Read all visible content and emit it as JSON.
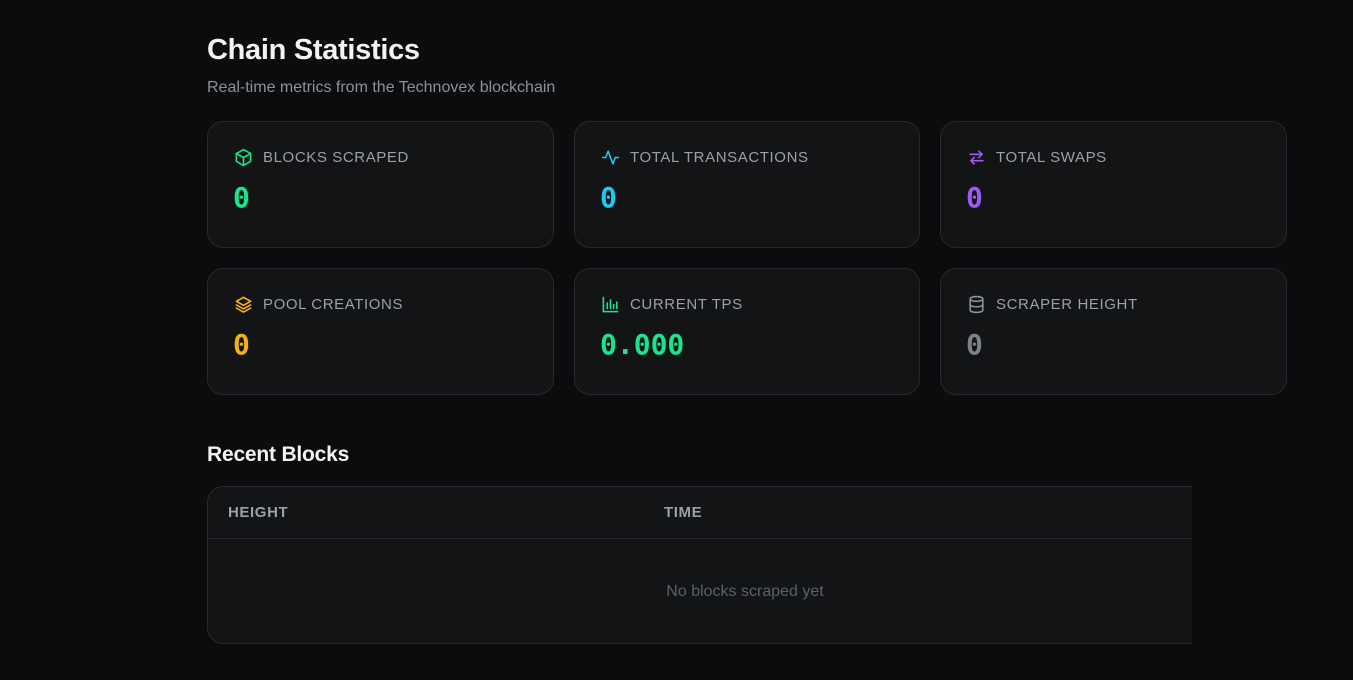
{
  "header": {
    "title": "Chain Statistics",
    "subtitle": "Real-time metrics from the Technovex blockchain"
  },
  "stats": [
    {
      "label": "BLOCKS SCRAPED",
      "value": "0",
      "icon": "cube-icon",
      "color": "#19e68c"
    },
    {
      "label": "TOTAL TRANSACTIONS",
      "value": "0",
      "icon": "activity-icon",
      "color": "#1fc8f0"
    },
    {
      "label": "TOTAL SWAPS",
      "value": "0",
      "icon": "swap-arrows-icon",
      "color": "#9b5cf6"
    },
    {
      "label": "POOL CREATIONS",
      "value": "0",
      "icon": "layers-icon",
      "color": "#f5b014"
    },
    {
      "label": "CURRENT TPS",
      "value": "0.000",
      "icon": "bar-chart-icon",
      "color": "#19e68c"
    },
    {
      "label": "SCRAPER HEIGHT",
      "value": "0",
      "icon": "database-icon",
      "color": "#7c818a"
    }
  ],
  "recent_blocks": {
    "title": "Recent Blocks",
    "columns": [
      "HEIGHT",
      "TIME"
    ],
    "empty_message": "No blocks scraped yet"
  }
}
